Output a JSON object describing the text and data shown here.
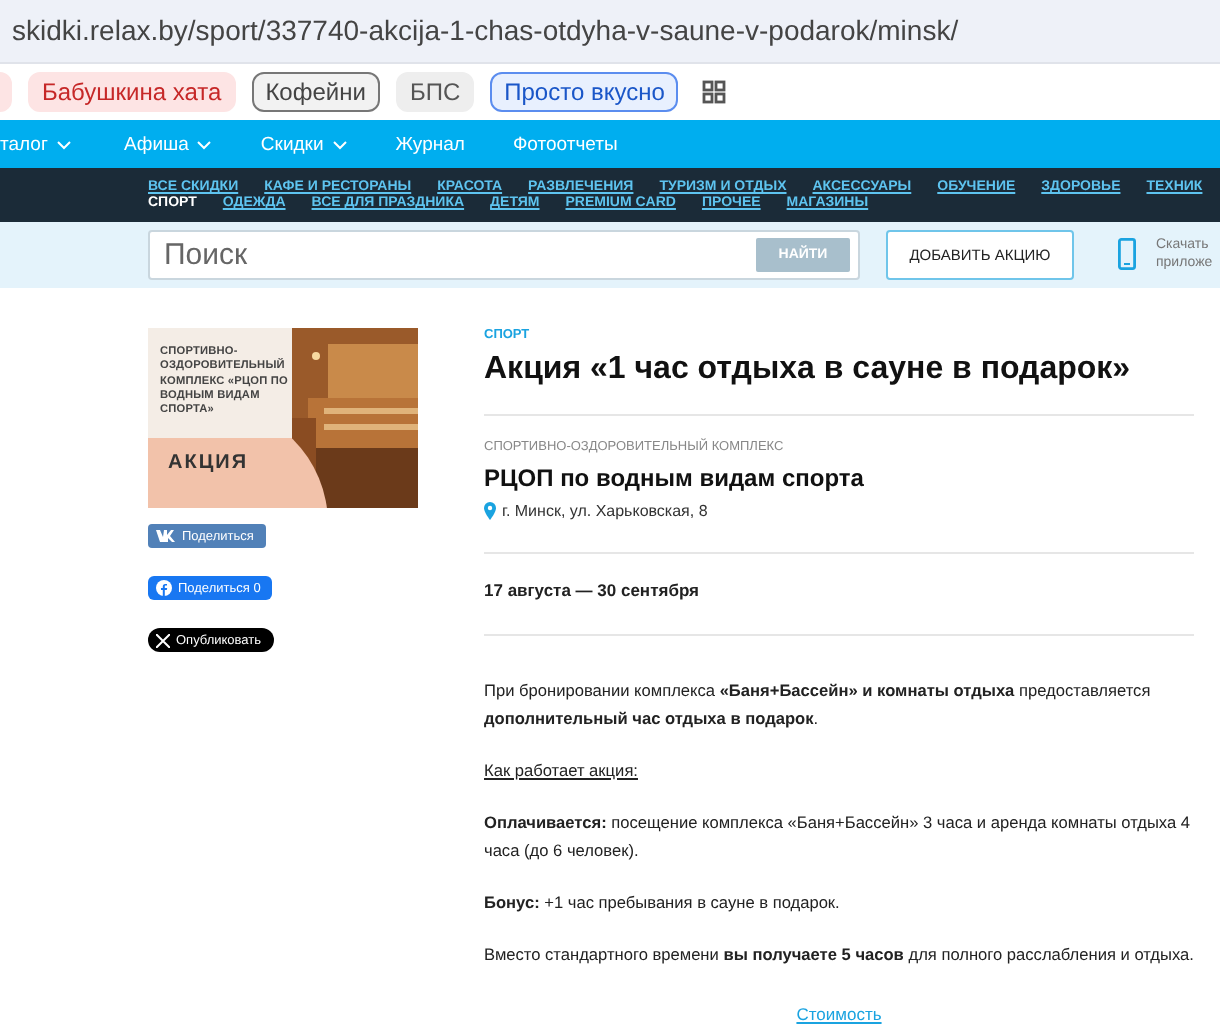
{
  "address_bar": {
    "url": "skidki.relax.by/sport/337740-akcija-1-chas-otdyha-v-saune-v-podarok/minsk/"
  },
  "bookmarks": [
    {
      "kind": "pink"
    },
    {
      "label": "Бабушкина хата",
      "kind": "pink"
    },
    {
      "label": "Кофейни",
      "kind": "outlined"
    },
    {
      "label": "БПС",
      "kind": "grey"
    },
    {
      "label": "Просто вкусно",
      "kind": "blue"
    }
  ],
  "main_nav": [
    {
      "label": "талог",
      "dropdown": true
    },
    {
      "label": "Афиша",
      "dropdown": true
    },
    {
      "label": "Скидки",
      "dropdown": true
    },
    {
      "label": "Журнал",
      "dropdown": false
    },
    {
      "label": "Фотоотчеты",
      "dropdown": false
    }
  ],
  "categories": [
    [
      {
        "label": "ВСЕ СКИДКИ",
        "selected": false
      },
      {
        "label": "КАФЕ И РЕСТОРАНЫ",
        "selected": false
      },
      {
        "label": "КРАСОТА",
        "selected": false
      },
      {
        "label": "РАЗВЛЕЧЕНИЯ",
        "selected": false
      },
      {
        "label": "ТУРИЗМ И ОТДЫХ",
        "selected": false
      },
      {
        "label": "АКСЕССУАРЫ",
        "selected": false
      },
      {
        "label": "ОБУЧЕНИЕ",
        "selected": false
      },
      {
        "label": "ЗДОРОВЬЕ",
        "selected": false
      },
      {
        "label": "ТЕХНИК",
        "selected": false
      }
    ],
    [
      {
        "label": "СПОРТ",
        "selected": true
      },
      {
        "label": "ОДЕЖДА",
        "selected": false
      },
      {
        "label": "ВСЕ ДЛЯ ПРАЗДНИКА",
        "selected": false
      },
      {
        "label": "ДЕТЯМ",
        "selected": false
      },
      {
        "label": "PREMIUM CARD",
        "selected": false
      },
      {
        "label": "ПРОЧЕЕ",
        "selected": false
      },
      {
        "label": "МАГАЗИНЫ",
        "selected": false
      }
    ]
  ],
  "search": {
    "placeholder": "Поиск",
    "button": "НАЙТИ"
  },
  "add_button": "ДОБАВИТЬ АКЦИЮ",
  "app_promo": [
    "Скачать",
    "приложе"
  ],
  "promo_image": {
    "kind": "picture",
    "caption": "СПОРТИВНО-ОЗДОРОВИТЕЛЬНЫЙ КОМПЛЕКС «РЦОП ПО ВОДНЫМ ВИДАМ СПОРТА»",
    "badge": "АКЦИЯ"
  },
  "share_buttons": [
    {
      "kind": "vk",
      "label": "Поделиться"
    },
    {
      "kind": "facebook",
      "label": "Поделиться 0"
    },
    {
      "kind": "x",
      "label": "Опубликовать"
    }
  ],
  "category": "СПОРТ",
  "title": "Акция «1 час отдыха в сауне в подарок»",
  "venue_type": "СПОРТИВНО-ОЗДОРОВИТЕЛЬНЫЙ КОМПЛЕКС",
  "venue_name": "РЦОП по водным видам спорта",
  "address": "г. Минск, ул. Харьковская, 8",
  "dates": "17 августа — 30 сентября",
  "paragraphs": [
    {
      "kind": "text",
      "text": "При бронировании комплекса **«Баня+Бассейн» и комнаты отдыха** предоставляется **дополнительный час отдыха в подарок**."
    },
    {
      "kind": "underline",
      "text": "Как работает акция:"
    },
    {
      "kind": "text",
      "text": "**Оплачивается:** посещение комплекса «Баня+Бассейн» 3 часа и аренда комнаты отдыха 4 часа (до 6 человек)."
    },
    {
      "kind": "text",
      "text": "**Бонус:** +1 час пребывания в сауне в подарок."
    },
    {
      "kind": "text",
      "text": "Вместо стандартного времени **вы получаете 5 часов** для полного расслабления и отдыха."
    }
  ],
  "price_link": "Стоимость"
}
